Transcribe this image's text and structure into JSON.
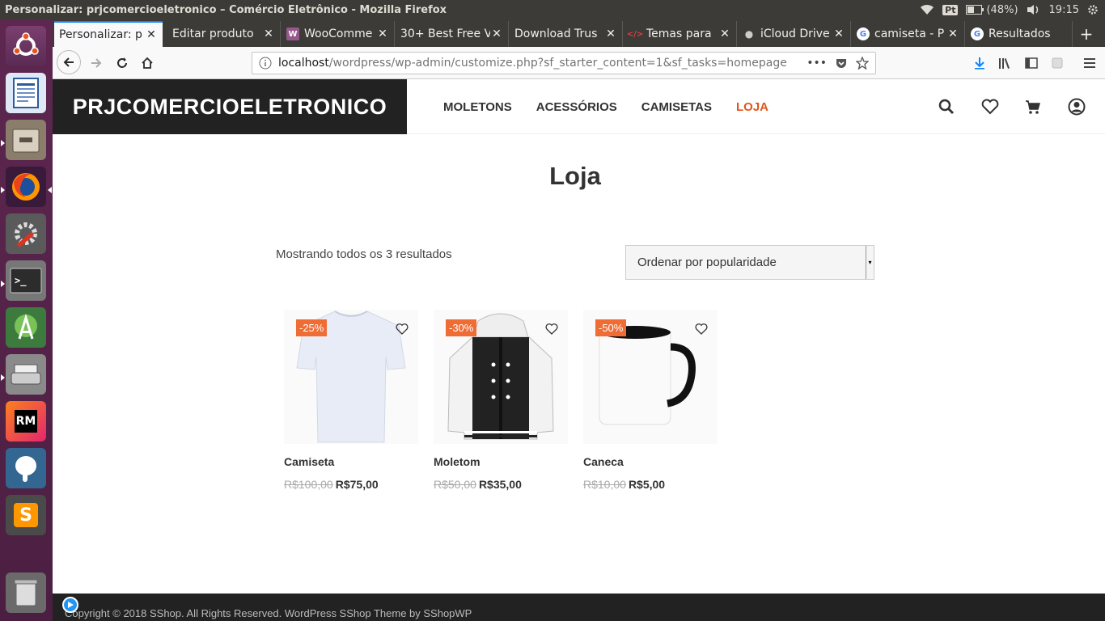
{
  "system_bar": {
    "window_title": "Personalizar: prjcomercioeletronico – Comércio Eletrônico - Mozilla Firefox",
    "keyboard": "Pt",
    "battery": "(48%)",
    "time": "19:15"
  },
  "launcher": {
    "items": [
      {
        "name": "ubuntu-dash-icon"
      },
      {
        "name": "libreoffice-writer-icon"
      },
      {
        "name": "files-icon"
      },
      {
        "name": "firefox-icon"
      },
      {
        "name": "system-settings-icon"
      },
      {
        "name": "terminal-icon"
      },
      {
        "name": "android-studio-icon"
      },
      {
        "name": "scanner-icon"
      },
      {
        "name": "rubymine-icon",
        "text": "RM"
      },
      {
        "name": "pgadmin-elephant-icon"
      },
      {
        "name": "sublime-text-icon",
        "text": "S"
      },
      {
        "name": "trash-icon"
      }
    ]
  },
  "browser": {
    "tabs": [
      {
        "label": "Personalizar: p",
        "active": true
      },
      {
        "label": "Editar produto"
      },
      {
        "label": "WooComme",
        "icon": "W"
      },
      {
        "label": "30+ Best Free V"
      },
      {
        "label": "Download Trus"
      },
      {
        "label": "Temas para"
      },
      {
        "label": "iCloud Drive"
      },
      {
        "label": "camiseta - P",
        "icon": "G"
      },
      {
        "label": "Resultados",
        "icon": "G"
      }
    ],
    "url_host": "localhost",
    "url_rest": "/wordpress/wp-admin/customize.php?sf_starter_content=1&sf_tasks=homepage"
  },
  "site": {
    "brand": "PRJCOMERCIOELETRONICO",
    "nav": [
      "MOLETONS",
      "ACESSÓRIOS",
      "CAMISETAS",
      "LOJA"
    ],
    "page_title": "Loja",
    "result_count": "Mostrando todos os 3 resultados",
    "orderby_selected": "Ordenar por popularidade",
    "products": [
      {
        "name": "Camiseta",
        "discount": "-25%",
        "old_price": "R$100,00",
        "new_price": "R$75,00"
      },
      {
        "name": "Moletom",
        "discount": "-30%",
        "old_price": "R$50,00",
        "new_price": "R$35,00"
      },
      {
        "name": "Caneca",
        "discount": "-50%",
        "old_price": "R$10,00",
        "new_price": "R$5,00"
      }
    ],
    "footer": "Copyright © 2018 SShop. All Rights Reserved. WordPress SShop Theme by SShopWP",
    "accent_color": "#e2551a",
    "badge_color": "#ef6c35"
  }
}
